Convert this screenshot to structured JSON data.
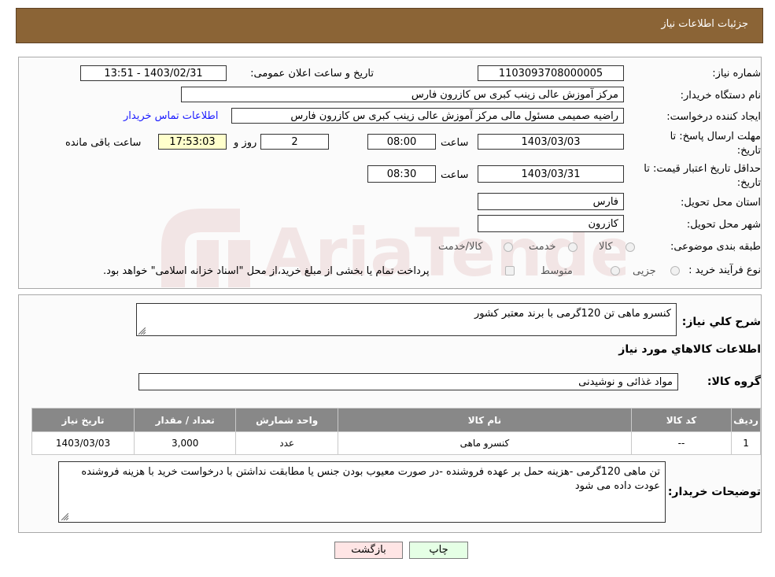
{
  "header": {
    "title": "جزئیات اطلاعات نیاز"
  },
  "form": {
    "need_number_label": "شماره نیاز:",
    "need_number": "1103093708000005",
    "announce_label": "تاریخ و ساعت اعلان عمومی:",
    "announce_value": "1403/02/31 - 13:51",
    "buyer_org_label": "نام دستگاه خریدار:",
    "buyer_org": "مرکز آموزش عالی زینب کبری س  کازرون فارس",
    "creator_label": "ایجاد کننده درخواست:",
    "creator": "راضیه صمیمی مسئول مالی مرکز آموزش عالی زینب کبری س  کازرون فارس",
    "contact_link": "اطلاعات تماس خریدار",
    "deadline_label_1": "مهلت ارسال پاسخ: تا",
    "deadline_label_2": "تاریخ:",
    "deadline_date": "1403/03/03",
    "time_label": "ساعت",
    "deadline_time": "08:00",
    "days_value": "2",
    "days_label": "روز و",
    "remaining_time": "17:53:03",
    "remaining_label": "ساعت باقی مانده",
    "validity_label_1": "حداقل تاریخ اعتبار قیمت: تا",
    "validity_label_2": "تاریخ:",
    "validity_date": "1403/03/31",
    "validity_time": "08:30",
    "province_label": "استان محل تحویل:",
    "province": "فارس",
    "city_label": "شهر محل تحویل:",
    "city": "کازرون",
    "category_label": "طبقه بندی موضوعی:",
    "category_options": [
      "کالا",
      "خدمت",
      "کالا/خدمت"
    ],
    "process_label": "نوع فرآیند خرید :",
    "process_options": [
      "جزیی",
      "متوسط"
    ],
    "process_note": "پرداخت تمام یا بخشی از مبلغ خرید،از محل \"اسناد خزانه اسلامی\" خواهد بود."
  },
  "details": {
    "summary_label": "شرح کلي نياز:",
    "summary": "کنسرو ماهی تن 120گرمی با برند معتبر کشور",
    "goods_info_title": "اطلاعات کالاهاي مورد نياز",
    "group_label": "گروه کالا:",
    "group_value": "مواد غذائی و نوشیدنی",
    "table": {
      "columns": [
        "ردیف",
        "کد کالا",
        "نام کالا",
        "واحد شمارش",
        "تعداد / مقدار",
        "تاریخ نیاز"
      ],
      "rows": [
        [
          "1",
          "--",
          "کنسرو ماهی",
          "عدد",
          "3,000",
          "1403/03/03"
        ]
      ]
    },
    "buyer_notes_label": "توضیحات خریدار:",
    "buyer_notes": "تن ماهی 120گرمی -هزینه حمل بر عهده فروشنده -در صورت معیوب بودن جنس یا مطابقت نداشتن با درخواست خرید با هزینه فروشنده عودت داده می شود"
  },
  "buttons": {
    "print": "چاپ",
    "back": "بازگشت"
  },
  "colors": {
    "header_bg": "#8b6436",
    "table_header_bg": "#888888",
    "back_button_bg": "#ffe5e5",
    "print_button_bg": "#e5ffe5",
    "remaining_bg": "#ffffcc",
    "link": "#1a1aff"
  }
}
